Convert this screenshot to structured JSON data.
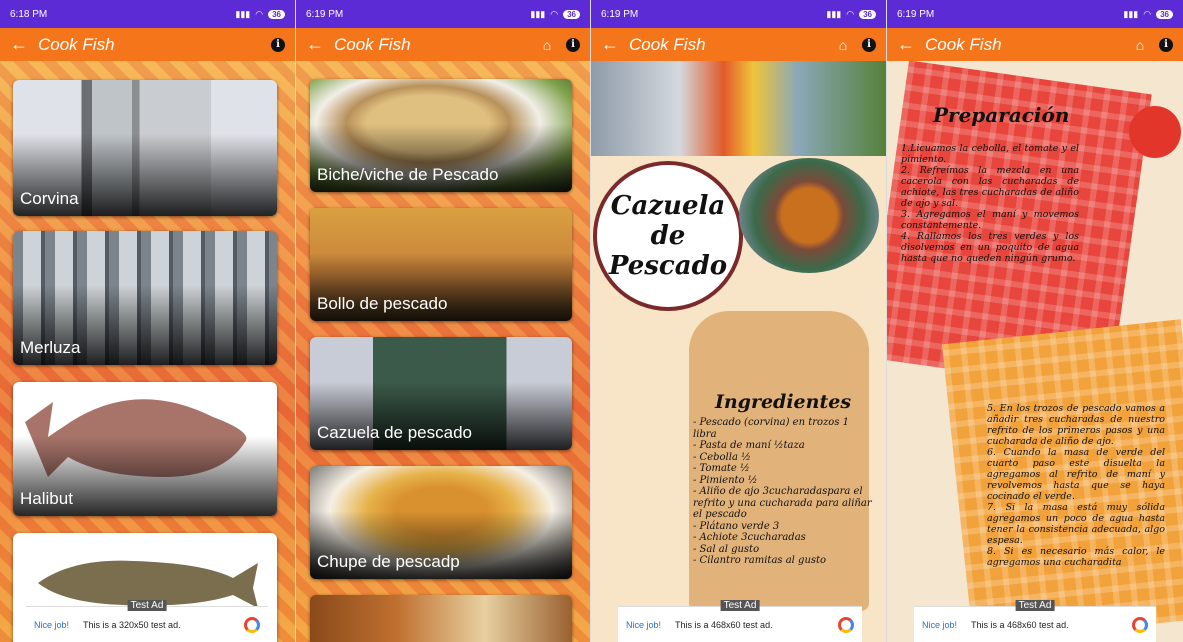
{
  "status_bar": [
    {
      "time": "6:18 PM",
      "battery": "36"
    },
    {
      "time": "6:19 PM",
      "battery": "36"
    },
    {
      "time": "6:19 PM",
      "battery": "36"
    },
    {
      "time": "6:19 PM",
      "battery": "36"
    }
  ],
  "app": {
    "title": "Cook Fish",
    "back_icon": "arrow-back-icon",
    "home_icon": "home-icon",
    "info_icon": "info-icon"
  },
  "screen1": {
    "cards": [
      {
        "label": "Corvina"
      },
      {
        "label": "Merluza"
      },
      {
        "label": "Halibut"
      },
      {
        "label": ""
      }
    ]
  },
  "screen2": {
    "cards": [
      {
        "label": "Biche/viche de Pescado"
      },
      {
        "label": "Bollo de pescado"
      },
      {
        "label": "Cazuela de pescado"
      },
      {
        "label": "Chupe de pescadp"
      }
    ]
  },
  "screen3": {
    "title_lines": [
      "Cazuela",
      "de",
      "Pescado"
    ],
    "ingredients_title": "Ingredientes",
    "ingredients": [
      "- Pescado (corvina) en trozos 1 libra",
      "- Pasta de maní ½taza",
      "- Cebolla ½",
      "- Tomate ½",
      "- Pimiento ½",
      "- Aliño de ajo 3cucharadaspara el refrito y una cucharada para aliñar el pescado",
      "- Plátano verde 3",
      "- Achiote 3cucharadas",
      "- Sal al gusto",
      "- Cilantro ramitas al gusto"
    ]
  },
  "screen4": {
    "prep_title": "Preparación",
    "steps_a": [
      "1.Licuamos la cebolla, el tomate y el pimiento.",
      "2. Refreímos la mezcla en una cacerola con las cucharadas de achiote, las tres cucharadas de aliño de ajo y sal.",
      "3. Agregamos el maní y movemos constantemente.",
      "4. Rallamos los tres verdes y los disolvemos en un poquito de agua hasta que no queden ningún grumo."
    ],
    "steps_b": [
      "5. En los trozos de pescado vamos a añadir tres cucharadas de nuestro refrito de los primeros pasos y una cucharada de aliño de ajo.",
      "6. Cuando la masa de verde del cuarto paso este disuelta la agregamos al refrito de maní y revolvemos hasta que se haya cocinado el verde.",
      "7. Si la masa está muy sólida agregamos un poco de agua hasta tener la consistencia adecuada, algo espesa.",
      "8. Si es necesario más calor, le agregamos una cucharadita"
    ]
  },
  "ads": [
    {
      "nice": "Nice job!",
      "text": "This is a 320x50 test ad.",
      "tag": "Test Ad"
    },
    {
      "nice": "Nice job!",
      "text": "This is a 468x60 test ad.",
      "tag": "Test Ad"
    },
    {
      "nice": "Nice job!",
      "text": "This is a 468x60 test ad.",
      "tag": "Test Ad"
    }
  ],
  "colors": {
    "status": "#5d2bd6",
    "appbar": "#f5761a"
  }
}
